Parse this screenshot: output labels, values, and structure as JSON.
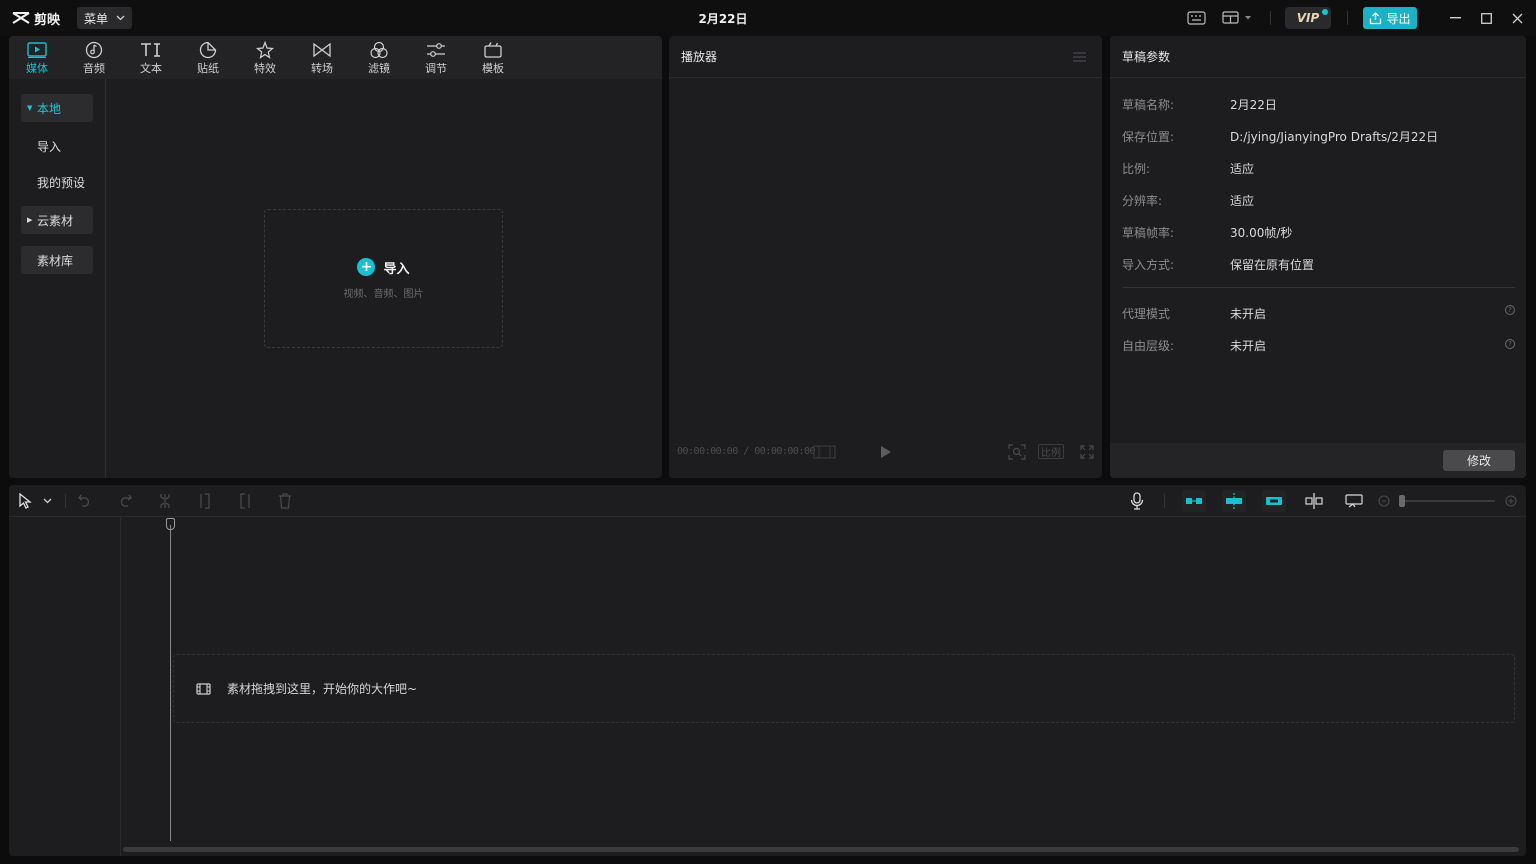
{
  "app": {
    "logo_text": "剪映",
    "menu_label": "菜单",
    "title": "2月22日",
    "vip_label": "VIP",
    "export_label": "导出",
    "icons": [
      "keyboard-icon",
      "layout-icon",
      "minimize-icon",
      "maximize-icon",
      "close-icon"
    ]
  },
  "media": {
    "tabs": [
      {
        "label": "媒体",
        "icon": "media-icon"
      },
      {
        "label": "音频",
        "icon": "audio-icon"
      },
      {
        "label": "文本",
        "icon": "text-icon"
      },
      {
        "label": "贴纸",
        "icon": "sticker-icon"
      },
      {
        "label": "特效",
        "icon": "effects-icon"
      },
      {
        "label": "转场",
        "icon": "transition-icon"
      },
      {
        "label": "滤镜",
        "icon": "filter-icon"
      },
      {
        "label": "调节",
        "icon": "adjust-icon"
      },
      {
        "label": "模板",
        "icon": "template-icon"
      }
    ],
    "active_tab": 0,
    "sidebar": {
      "local": "本地",
      "import": "导入",
      "presets": "我的预设",
      "cloud": "云素材",
      "library": "素材库"
    },
    "import_box": {
      "label": "导入",
      "hint": "视频、音频、图片"
    }
  },
  "player": {
    "title": "播放器",
    "timecode": "00:00:00:00 / 00:00:00:00",
    "ratio_label": "比例"
  },
  "props": {
    "title": "草稿参数",
    "rows": [
      {
        "key": "草稿名称:",
        "value": "2月22日"
      },
      {
        "key": "保存位置:",
        "value": "D:/jying/JianyingPro Drafts/2月22日"
      },
      {
        "key": "比例:",
        "value": "适应"
      },
      {
        "key": "分辨率:",
        "value": "适应"
      },
      {
        "key": "草稿帧率:",
        "value": "30.00帧/秒"
      },
      {
        "key": "导入方式:",
        "value": "保留在原有位置"
      }
    ],
    "extra_rows": [
      {
        "key": "代理模式",
        "value": "未开启"
      },
      {
        "key": "自由层级:",
        "value": "未开启"
      }
    ],
    "modify_label": "修改"
  },
  "timeline": {
    "drop_hint": "素材拖拽到这里，开始你的大作吧~"
  },
  "colors": {
    "accent": "#19c0d1",
    "panel": "#1d1d1f",
    "background": "#0c0c0d"
  }
}
